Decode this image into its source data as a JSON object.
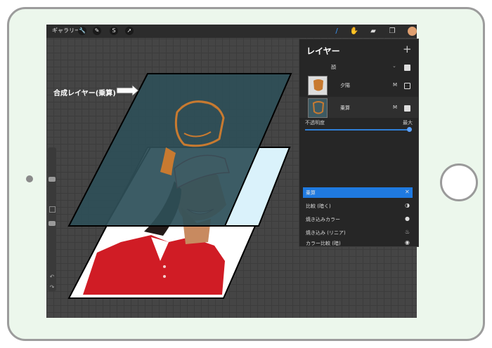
{
  "toolbar": {
    "gallery_label": "ギャラリー",
    "tools": [
      {
        "icon": "wrench-icon",
        "glyph": "🔧"
      },
      {
        "icon": "magic-wand-icon",
        "glyph": "✎"
      },
      {
        "icon": "selection-icon",
        "glyph": "S"
      },
      {
        "icon": "transform-icon",
        "glyph": "➚"
      }
    ],
    "right_tools": [
      {
        "icon": "brush-icon",
        "glyph": "/"
      },
      {
        "icon": "smudge-icon",
        "glyph": "✋"
      },
      {
        "icon": "eraser-icon",
        "glyph": "▰"
      },
      {
        "icon": "layers-icon",
        "glyph": "❐"
      }
    ],
    "color_swatch": "#e0a070"
  },
  "canvas": {
    "annotation": "合成レイヤー(乗算)"
  },
  "layers_panel": {
    "title": "レイヤー",
    "add_icon": "+",
    "group_row": {
      "name": "顔"
    },
    "layers": [
      {
        "name": "夕陽",
        "mode": "M",
        "visible": false
      },
      {
        "name": "乗算",
        "mode": "M",
        "visible": true
      }
    ],
    "opacity_label": "不透明度",
    "opacity_max_label": "最大",
    "opacity": 1.0,
    "blend_modes": [
      {
        "label": "乗算",
        "selected": true,
        "icon": "✕"
      },
      {
        "label": "比較 (暗く)",
        "selected": false,
        "icon": "◑"
      },
      {
        "label": "焼き込みカラー",
        "selected": false,
        "icon": "●"
      },
      {
        "label": "焼き込み (リニア)",
        "selected": false,
        "icon": "♨"
      },
      {
        "label": "カラー比較 (暗)",
        "selected": false,
        "icon": "◉"
      }
    ]
  }
}
